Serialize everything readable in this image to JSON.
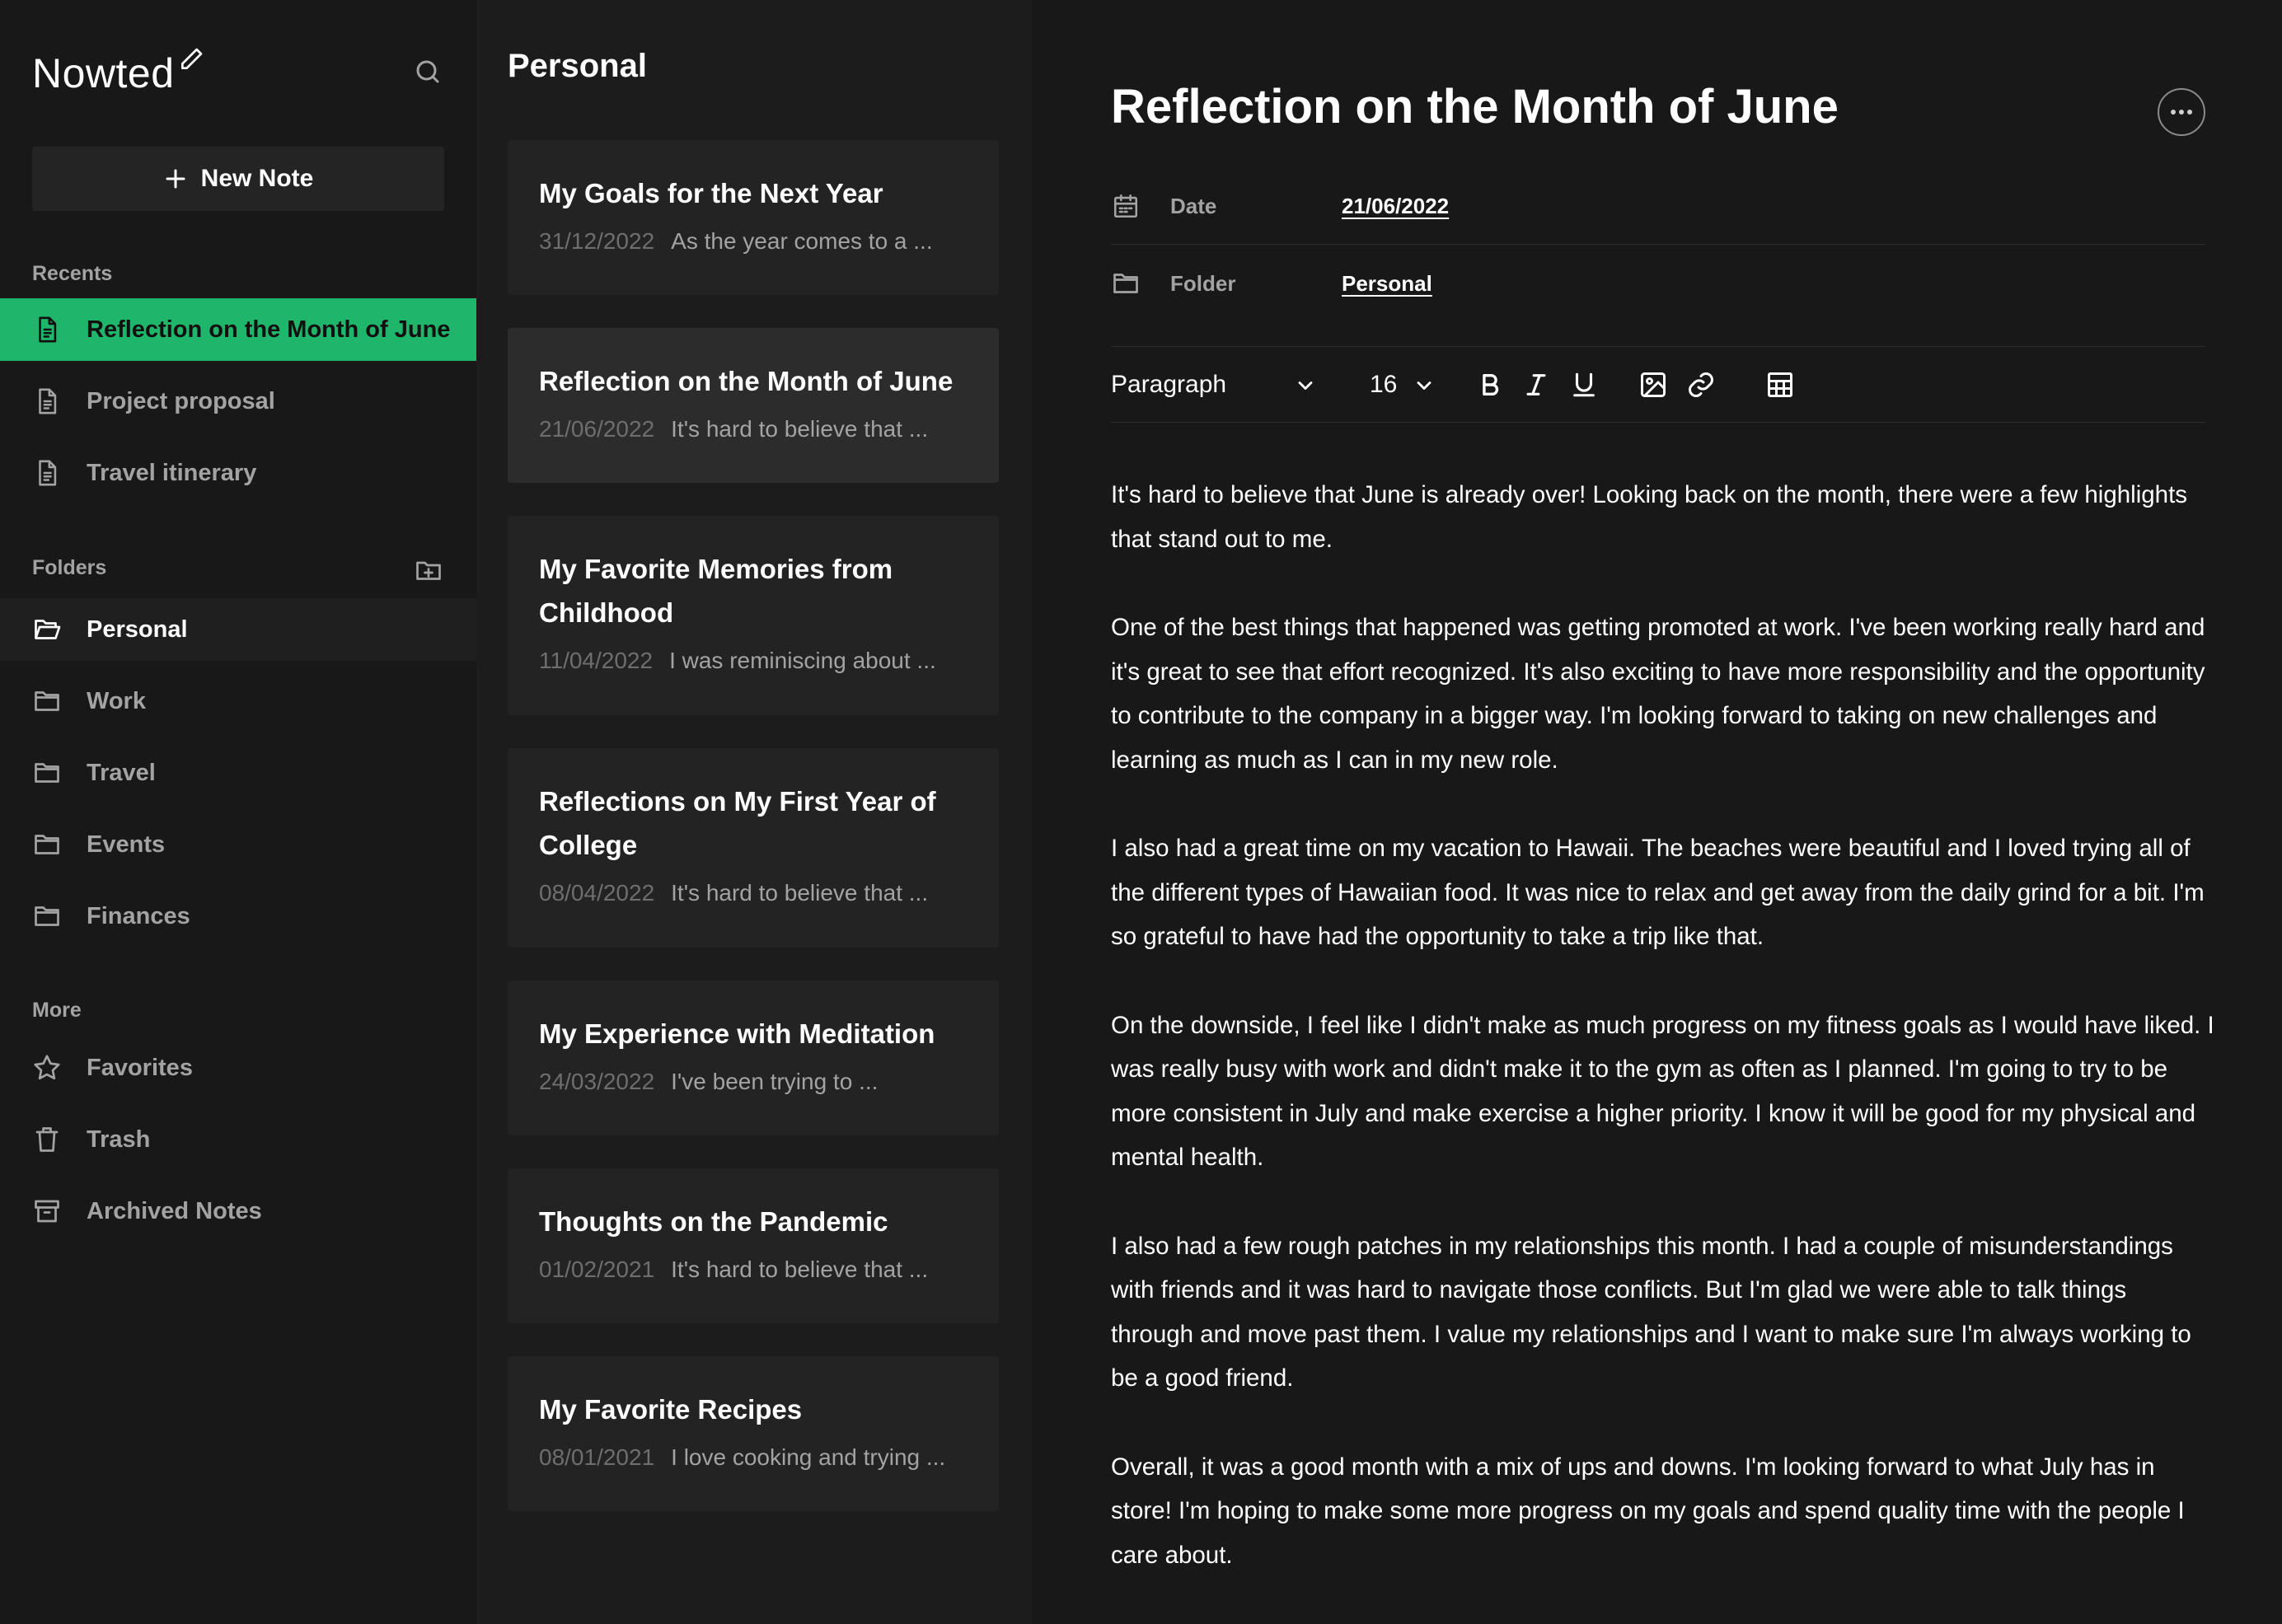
{
  "brand": {
    "name": "Nowted"
  },
  "sidebar": {
    "new_note_label": "New Note",
    "recents_label": "Recents",
    "recents": [
      {
        "label": "Reflection on the Month of June",
        "active": true
      },
      {
        "label": "Project proposal",
        "active": false
      },
      {
        "label": "Travel itinerary",
        "active": false
      }
    ],
    "folders_label": "Folders",
    "folders": [
      {
        "label": "Personal",
        "active": true
      },
      {
        "label": "Work",
        "active": false
      },
      {
        "label": "Travel",
        "active": false
      },
      {
        "label": "Events",
        "active": false
      },
      {
        "label": "Finances",
        "active": false
      }
    ],
    "more_label": "More",
    "more": [
      {
        "label": "Favorites",
        "icon": "star-icon"
      },
      {
        "label": "Trash",
        "icon": "trash-icon"
      },
      {
        "label": "Archived Notes",
        "icon": "archive-icon"
      }
    ]
  },
  "note_list": {
    "title": "Personal",
    "notes": [
      {
        "title": "My Goals for the Next Year",
        "date": "31/12/2022",
        "preview": "As the year comes to a ..."
      },
      {
        "title": "Reflection on the Month of June",
        "date": "21/06/2022",
        "preview": "It's hard to believe that ..."
      },
      {
        "title": "My Favorite Memories from Childhood",
        "date": "11/04/2022",
        "preview": "I was reminiscing about ..."
      },
      {
        "title": "Reflections on My First Year of College",
        "date": "08/04/2022",
        "preview": "It's hard to believe that ..."
      },
      {
        "title": "My Experience with Meditation",
        "date": "24/03/2022",
        "preview": "I've been trying to ..."
      },
      {
        "title": "Thoughts on the Pandemic",
        "date": "01/02/2021",
        "preview": "It's hard to believe that ..."
      },
      {
        "title": "My Favorite Recipes",
        "date": "08/01/2021",
        "preview": "I love cooking and trying ..."
      }
    ]
  },
  "editor": {
    "title": "Reflection on the Month of June",
    "date_label": "Date",
    "date_value": "21/06/2022",
    "folder_label": "Folder",
    "folder_value": "Personal",
    "toolbar": {
      "block_type": "Paragraph",
      "font_size": "16"
    },
    "paragraphs": [
      "It's hard to believe that June is already over! Looking back on the month, there were a few highlights that stand out to me.",
      "One of the best things that happened was getting promoted at work. I've been working really hard and it's great to see that effort recognized. It's also exciting to have more responsibility and the opportunity to contribute to the company in a bigger way. I'm looking forward to taking on new challenges and learning as much as I can in my new role.",
      "I also had a great time on my vacation to Hawaii. The beaches were beautiful and I loved trying all of the different types of Hawaiian food. It was nice to relax and get away from the daily grind for a bit. I'm so grateful to have had the opportunity to take a trip like that.",
      "On the downside, I feel like I didn't make as much progress on my fitness goals as I would have liked. I was really busy with work and didn't make it to the gym as often as I planned. I'm going to try to be more consistent in July and make exercise a higher priority. I know it will be good for my physical and mental health.",
      "I also had a few rough patches in my relationships this month. I had a couple of misunderstandings with friends and it was hard to navigate those conflicts. But I'm glad we were able to talk things through and move past them. I value my relationships and I want to make sure I'm always working to be a good friend.",
      "Overall, it was a good month with a mix of ups and downs. I'm looking forward to what July has in store! I'm hoping to make some more progress on my goals and spend quality time with the people I care about."
    ]
  },
  "colors": {
    "accent": "#1fb56a",
    "background": "#181818",
    "panel": "#1c1c1c",
    "card": "#232323"
  }
}
